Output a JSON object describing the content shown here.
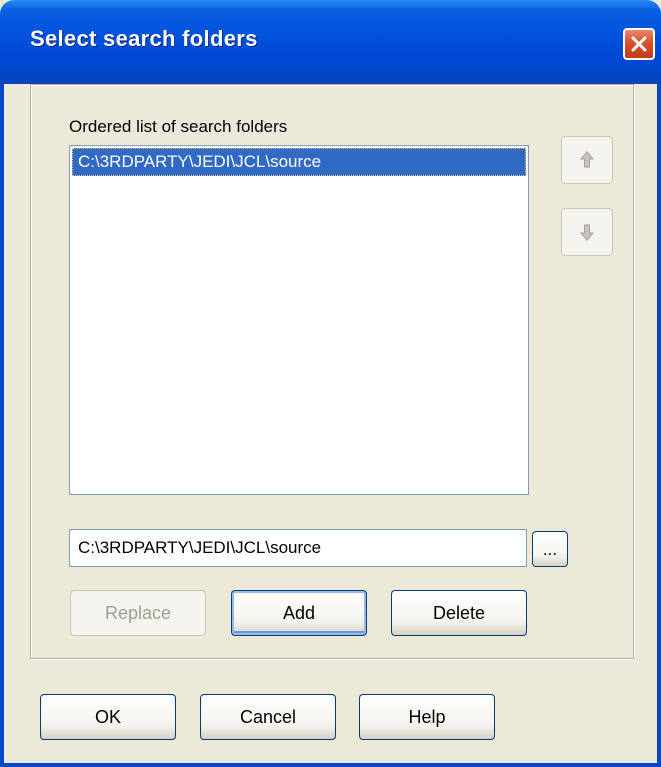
{
  "window": {
    "title": "Select search folders",
    "close_icon": "close-x-icon",
    "title_bar_color": "#0050dc",
    "close_color": "#d9502c"
  },
  "folders": {
    "caption": "Ordered list of search folders",
    "items": [
      {
        "path": "C:\\3RDPARTY\\JEDI\\JCL\\source",
        "selected": true
      }
    ],
    "selection_color": "#316ac5",
    "move_up_icon": "arrow-up-icon",
    "move_down_icon": "arrow-down-icon"
  },
  "path": {
    "value": "C:\\3RDPARTY\\JEDI\\JCL\\source",
    "browse_label": "..."
  },
  "actions": {
    "replace_label": "Replace",
    "replace_enabled": false,
    "add_label": "Add",
    "delete_label": "Delete"
  },
  "footer": {
    "ok_label": "OK",
    "cancel_label": "Cancel",
    "help_label": "Help"
  }
}
